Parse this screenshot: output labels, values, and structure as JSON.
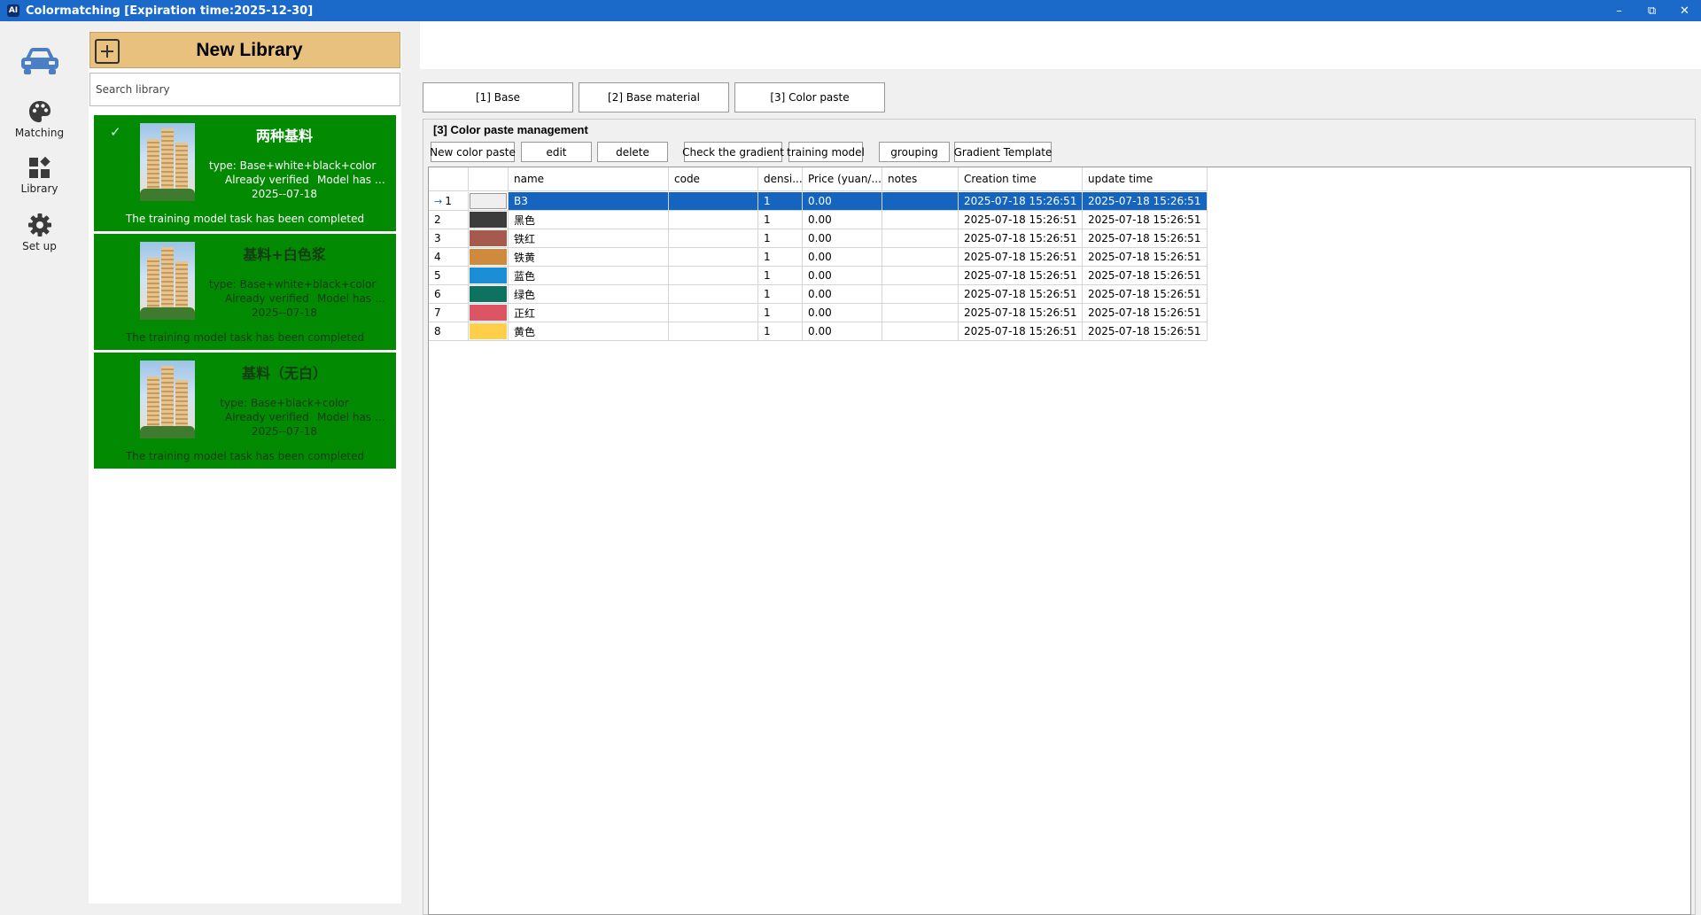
{
  "window": {
    "logo": "AI",
    "title": "Colormatching  [Expiration time:2025-12-30]",
    "minimize": "–",
    "restore": "⧉",
    "close": "✕"
  },
  "nav": {
    "matching": "Matching",
    "library": "Library",
    "setup": "Set up"
  },
  "library": {
    "new_label": "New Library",
    "search_placeholder": "Search library",
    "cards": [
      {
        "name": "两种基料",
        "type": "type: Base+white+black+color",
        "verified": "Already verified",
        "model": "Model has b...",
        "date": "2025--07-18",
        "task": "The training model task has been completed"
      },
      {
        "name": "基料+白色浆",
        "type": "type: Base+white+black+color",
        "verified": "Already verified",
        "model": "Model has b...",
        "date": "2025--07-18",
        "task": "The training model task has been completed"
      },
      {
        "name": "基料（无白）",
        "type": "type: Base+black+color",
        "verified": "Already verified",
        "model": "Model has b...",
        "date": "2025--07-18",
        "task": "The training model task has been completed"
      }
    ]
  },
  "tabs": [
    "[1] Base",
    "[2] Base material",
    "[3] Color paste"
  ],
  "panel": {
    "title": "[3] Color paste management",
    "buttons": [
      "New color paste",
      "edit",
      "delete",
      "Check the gradient",
      "training model",
      "grouping",
      "Gradient Template"
    ]
  },
  "table": {
    "headers": [
      "",
      "",
      "name",
      "code",
      "densi...",
      "Price (yuan/...",
      "notes",
      "Creation time",
      "update time"
    ],
    "selected_marker": "→",
    "rows": [
      {
        "num": "1",
        "color": "#efefef",
        "name": "B3",
        "code": "",
        "density": "1",
        "price": "0.00",
        "notes": "",
        "created": "2025-07-18 15:26:51",
        "updated": "2025-07-18 15:26:51"
      },
      {
        "num": "2",
        "color": "#3c3c3c",
        "name": "黑色",
        "code": "",
        "density": "1",
        "price": "0.00",
        "notes": "",
        "created": "2025-07-18 15:26:51",
        "updated": "2025-07-18 15:26:51"
      },
      {
        "num": "3",
        "color": "#a65a4d",
        "name": "铁红",
        "code": "",
        "density": "1",
        "price": "0.00",
        "notes": "",
        "created": "2025-07-18 15:26:51",
        "updated": "2025-07-18 15:26:51"
      },
      {
        "num": "4",
        "color": "#d08a3e",
        "name": "铁黄",
        "code": "",
        "density": "1",
        "price": "0.00",
        "notes": "",
        "created": "2025-07-18 15:26:51",
        "updated": "2025-07-18 15:26:51"
      },
      {
        "num": "5",
        "color": "#1c8ed6",
        "name": "蓝色",
        "code": "",
        "density": "1",
        "price": "0.00",
        "notes": "",
        "created": "2025-07-18 15:26:51",
        "updated": "2025-07-18 15:26:51"
      },
      {
        "num": "6",
        "color": "#0d7360",
        "name": "绿色",
        "code": "",
        "density": "1",
        "price": "0.00",
        "notes": "",
        "created": "2025-07-18 15:26:51",
        "updated": "2025-07-18 15:26:51"
      },
      {
        "num": "7",
        "color": "#dc5564",
        "name": "正红",
        "code": "",
        "density": "1",
        "price": "0.00",
        "notes": "",
        "created": "2025-07-18 15:26:51",
        "updated": "2025-07-18 15:26:51"
      },
      {
        "num": "8",
        "color": "#ffcf4a",
        "name": "黄色",
        "code": "",
        "density": "1",
        "price": "0.00",
        "notes": "",
        "created": "2025-07-18 15:26:51",
        "updated": "2025-07-18 15:26:51"
      }
    ]
  },
  "colors": {
    "titlebar": "#1b6ac9",
    "card_bg": "#028a02",
    "new_library_bg": "#e9c17f",
    "selected_row": "#1565c0",
    "nav_car": "#4a7fc4"
  }
}
